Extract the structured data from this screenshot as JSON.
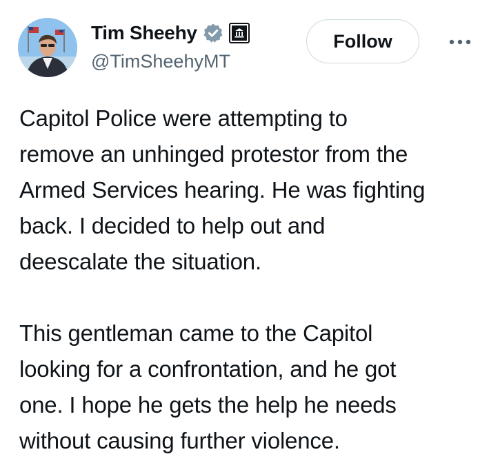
{
  "author": {
    "display_name": "Tim Sheehy",
    "handle": "@TimSheehyMT",
    "avatar_icon": "profile-photo",
    "verified_badge_icon": "verified-badge-icon",
    "affiliation_badge_icon": "government-building-icon"
  },
  "actions": {
    "follow_label": "Follow",
    "more_icon": "more-options-icon"
  },
  "tweet": {
    "paragraphs": [
      {
        "lines": [
          "Capitol Police were attempting to",
          "remove an unhinged protestor from the",
          "Armed Services hearing. He was fighting",
          "back. I decided to help out and",
          "deescalate the situation."
        ]
      },
      {
        "lines": [
          "This gentleman came to the Capitol",
          "looking for a confrontation, and he got",
          "one. I hope he gets the help he needs",
          "without causing further violence."
        ]
      }
    ]
  },
  "colors": {
    "text_primary": "#0f1419",
    "text_secondary": "#536471",
    "border": "#cfd9de",
    "verified_badge": "#829aab"
  }
}
